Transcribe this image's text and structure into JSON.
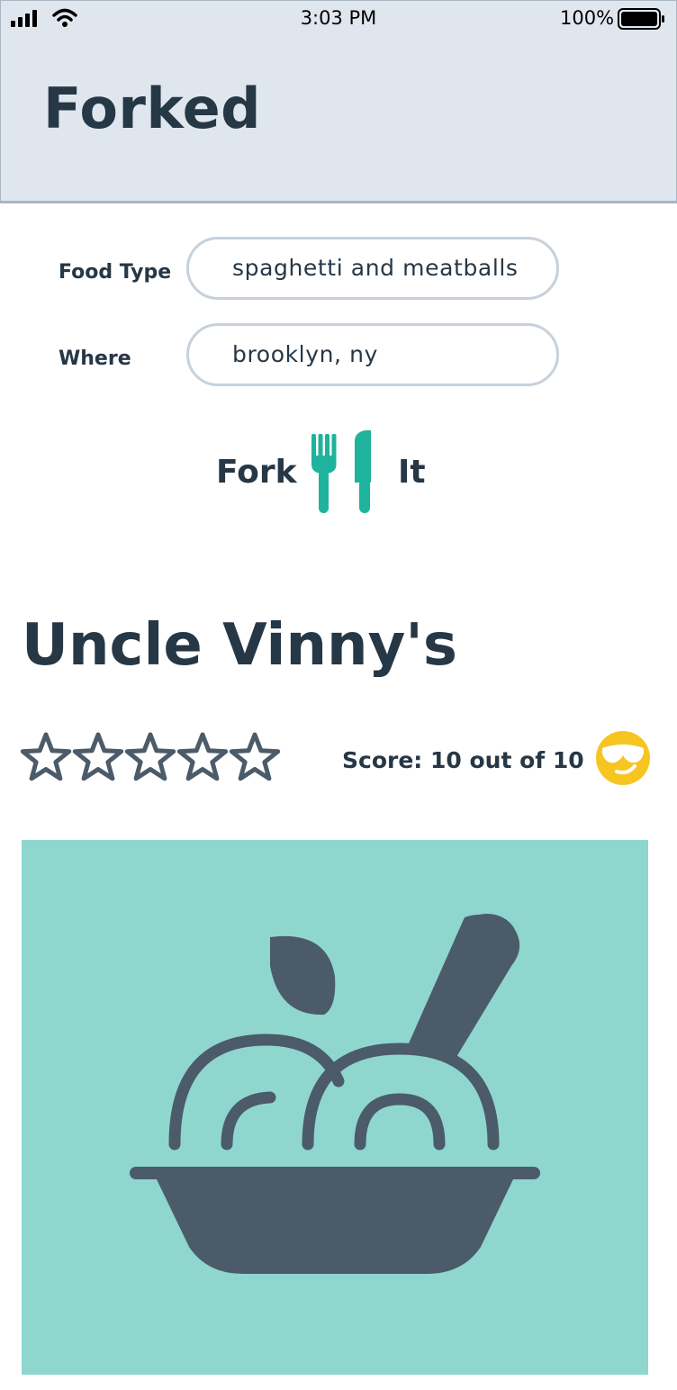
{
  "status_bar": {
    "time": "3:03 PM",
    "battery_percent": "100%"
  },
  "app": {
    "title": "Forked"
  },
  "search": {
    "food_type_label": "Food Type",
    "food_type_value": "spaghetti and meatballs",
    "where_label": "Where",
    "where_value": "brooklyn, ny"
  },
  "fork_it_button": {
    "word1": "Fork",
    "word2": "It",
    "icon": "fork-knife-icon"
  },
  "result": {
    "name": "Uncle Vinny's",
    "stars_filled": 0,
    "stars_total": 5,
    "score_text": "Score: 10 out of 10",
    "emoji_icon": "cool-sunglasses-emoji-icon",
    "image_icon": "pasta-bowl-icon"
  },
  "colors": {
    "header_bg": "#dfe6ee",
    "text_dark": "#263746",
    "accent_teal": "#1fb39e",
    "photo_bg": "#8fd6cf",
    "icon_slate": "#4b5b69",
    "emoji_yellow": "#f7c520"
  }
}
